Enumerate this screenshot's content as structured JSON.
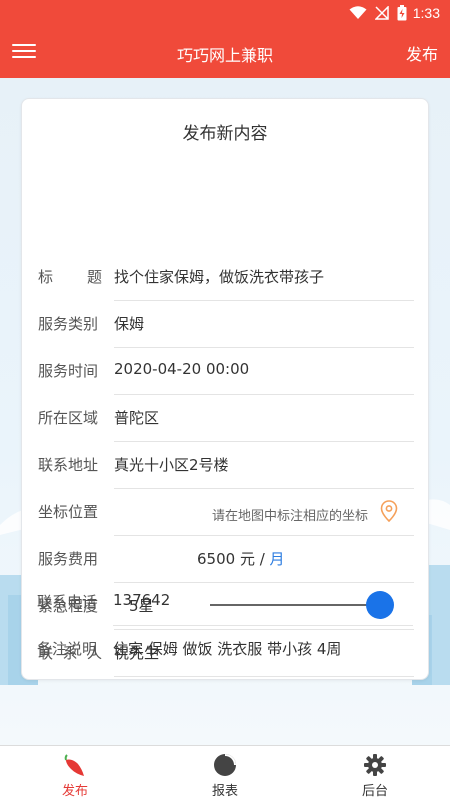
{
  "status_bar": {
    "time": "1:33"
  },
  "app_bar": {
    "title": "巧巧网上兼职",
    "publish_label": "发布"
  },
  "form": {
    "title": "发布新内容",
    "fields": {
      "title": {
        "label_chars": [
          "标",
          "题"
        ],
        "value": "找个住家保姆，做饭洗衣带孩子"
      },
      "category": {
        "label": "服务类别",
        "value": "保姆"
      },
      "time": {
        "label": "服务时间",
        "value": "2020-04-20 00:00"
      },
      "area": {
        "label": "所在区域",
        "value": "普陀区"
      },
      "address": {
        "label": "联系地址",
        "value": "真光十小区2号楼"
      },
      "location": {
        "label": "坐标位置",
        "hint": "请在地图中标注相应的坐标"
      },
      "fee": {
        "label": "服务费用",
        "amount": "6500 元",
        "separator": " / ",
        "unit": "月"
      },
      "urgency": {
        "label": "紧急程度",
        "value": "5星",
        "level_fraction": 1.0
      },
      "contact": {
        "label_chars": [
          "联",
          "系",
          "人"
        ],
        "value": "祝先生"
      },
      "phone": {
        "label": "联系电话",
        "value": "137642"
      },
      "notes": {
        "label": "备注说明",
        "value": "住家 保姆 做饭 洗衣服 带小孩 4周"
      }
    }
  },
  "bottom_nav": {
    "items": [
      {
        "label": "发布",
        "icon": "pepper-icon",
        "active": true
      },
      {
        "label": "报表",
        "icon": "pie-chart-icon",
        "active": false
      },
      {
        "label": "后台",
        "icon": "gear-icon",
        "active": false
      }
    ]
  },
  "colors": {
    "primary": "#f04a3a",
    "accent_blue": "#1a73e8",
    "active_nav": "#e53935"
  }
}
